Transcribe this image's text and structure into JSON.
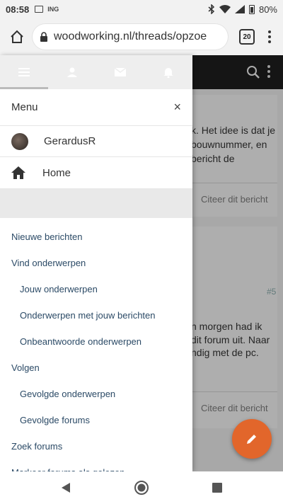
{
  "status": {
    "time": "08:58",
    "carrier": "ING",
    "battery": "80%"
  },
  "browser": {
    "url": "woodworking.nl/threads/opzoe",
    "tab_count": "20"
  },
  "page_bg": {
    "line1": "k. Het idee is dat je",
    "line2": "bouwnummer, en",
    "line3": "bericht de",
    "quote1": "Citeer dit bericht",
    "post_number": "#5",
    "line4": "n morgen had ik",
    "line5": "dit forum uit. Naar",
    "line6": "ndig met de pc.",
    "quote2": "Citeer dit bericht"
  },
  "drawer": {
    "title": "Menu",
    "close_label": "×",
    "user": {
      "name": "GerardusR"
    },
    "home": {
      "label": "Home"
    },
    "items": [
      {
        "label": "Nieuwe berichten",
        "level": 0
      },
      {
        "label": "Vind onderwerpen",
        "level": 0
      },
      {
        "label": "Jouw onderwerpen",
        "level": 1
      },
      {
        "label": "Onderwerpen met jouw berichten",
        "level": 1
      },
      {
        "label": "Onbeantwoorde onderwerpen",
        "level": 1
      },
      {
        "label": "Volgen",
        "level": 0
      },
      {
        "label": "Gevolgde onderwerpen",
        "level": 1
      },
      {
        "label": "Gevolgde forums",
        "level": 1
      },
      {
        "label": "Zoek forums",
        "level": 0
      },
      {
        "label": "Markeer forums als gelezen",
        "level": 0
      }
    ]
  },
  "colors": {
    "accent": "#e2662b",
    "link": "#2b4a66",
    "topnav": "#1e1e1e"
  },
  "icons": [
    "home-icon",
    "lock-icon",
    "hamburger-icon",
    "user-icon",
    "mail-icon",
    "bell-icon",
    "close-icon",
    "search-icon",
    "pencil-icon",
    "back-icon",
    "home-circle-icon",
    "recents-icon"
  ]
}
